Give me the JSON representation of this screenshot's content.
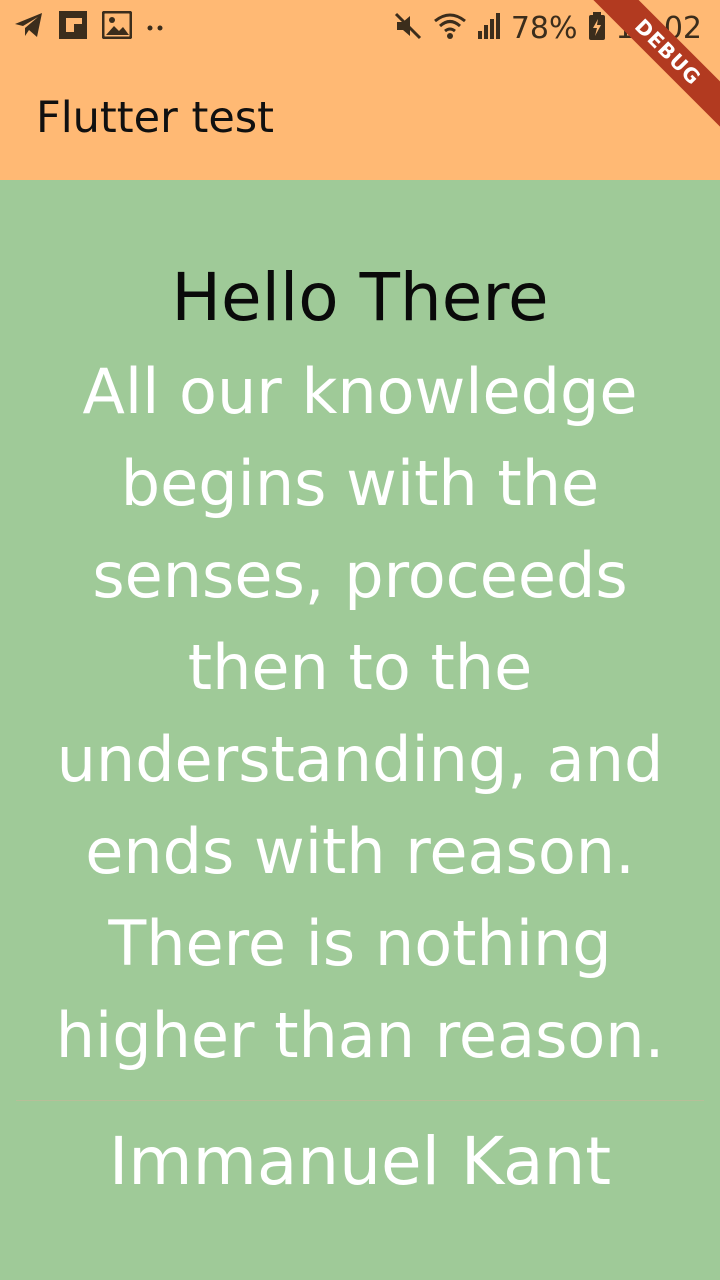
{
  "status_bar": {
    "battery_percent": "78%",
    "time": "12:02",
    "notification_icons": [
      "telegram-icon",
      "flipboard-icon",
      "gallery-icon",
      "more-notifications-icon"
    ],
    "system_icons": [
      "mute-icon",
      "wifi-icon",
      "signal-icon",
      "battery-charging-icon"
    ]
  },
  "app_bar": {
    "title": "Flutter test",
    "background": "#FFB974"
  },
  "debug_banner": {
    "label": "DEBUG",
    "color": "#b23a20"
  },
  "body": {
    "background": "#9FCA98",
    "heading": "Hello There",
    "quote_lines": [
      "All our knowledge",
      "begins with the",
      "senses, proceeds",
      "then to the",
      "understanding, and",
      "ends with reason.",
      "There is nothing",
      "higher than reason."
    ],
    "author": "Immanuel Kant"
  }
}
